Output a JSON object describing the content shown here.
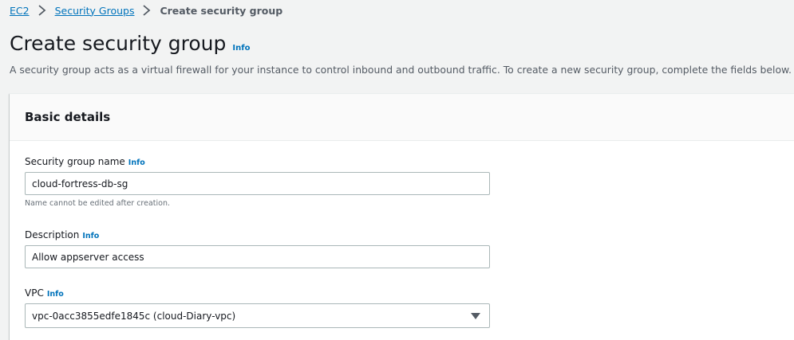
{
  "breadcrumb": {
    "items": [
      {
        "label": "EC2"
      },
      {
        "label": "Security Groups"
      }
    ],
    "current": "Create security group"
  },
  "header": {
    "title": "Create security group",
    "info": "Info",
    "description": "A security group acts as a virtual firewall for your instance to control inbound and outbound traffic. To create a new security group, complete the fields below."
  },
  "basic_details": {
    "title": "Basic details",
    "name_field": {
      "label": "Security group name",
      "info": "Info",
      "value": "cloud-fortress-db-sg",
      "constraint": "Name cannot be edited after creation."
    },
    "description_field": {
      "label": "Description",
      "info": "Info",
      "value": "Allow appserver access"
    },
    "vpc_field": {
      "label": "VPC",
      "info": "Info",
      "value": "vpc-0acc3855edfe1845c (cloud-Diary-vpc)"
    }
  },
  "colors": {
    "link": "#0073bb",
    "background": "#f2f3f3",
    "panel_header": "#fafafa"
  },
  "icons": {
    "breadcrumb_separator": "chevron-right-icon",
    "select_caret": "caret-down-icon"
  }
}
